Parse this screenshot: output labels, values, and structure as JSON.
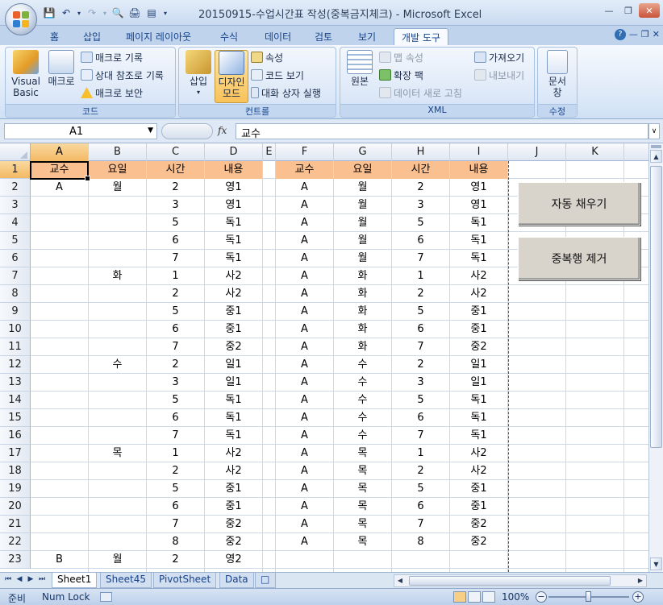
{
  "window": {
    "title": "20150915-수업시간표 작성(중복금지체크) - Microsoft Excel"
  },
  "tabs": [
    {
      "label": "홈"
    },
    {
      "label": "삽입"
    },
    {
      "label": "페이지 레이아웃"
    },
    {
      "label": "수식"
    },
    {
      "label": "데이터"
    },
    {
      "label": "검토"
    },
    {
      "label": "보기"
    },
    {
      "label": "개발 도구",
      "active": true
    }
  ],
  "ribbon": {
    "code": {
      "label": "코드",
      "visual_basic": "Visual Basic",
      "macro": "매크로",
      "record_macro": "매크로 기록",
      "relative_ref": "상대 참조로 기록",
      "macro_security": "매크로 보안"
    },
    "controls": {
      "label": "컨트롤",
      "insert": "삽입",
      "design_mode": "디자인 모드",
      "properties": "속성",
      "view_code": "코드 보기",
      "run_dialog": "대화 상자 실행"
    },
    "xml": {
      "label": "XML",
      "source": "원본",
      "map_properties": "맵 속성",
      "expansion_packs": "확장 팩",
      "refresh_data": "데이터 새로 고침",
      "import": "가져오기",
      "export": "내보내기"
    },
    "modify": {
      "label": "수정",
      "document_panel": "문서 창"
    }
  },
  "formula_bar": {
    "name_box": "A1",
    "fx": "fx",
    "value": "교수"
  },
  "columns": [
    "A",
    "B",
    "C",
    "D",
    "E",
    "F",
    "G",
    "H",
    "I",
    "J",
    "K"
  ],
  "rows": [
    "1",
    "2",
    "3",
    "4",
    "5",
    "6",
    "7",
    "8",
    "9",
    "10",
    "11",
    "12",
    "13",
    "14",
    "15",
    "16",
    "17",
    "18",
    "19",
    "20",
    "21",
    "22",
    "23"
  ],
  "left_table": {
    "headers": [
      "교수",
      "요일",
      "시간",
      "내용"
    ],
    "rows": [
      [
        "A",
        "월",
        "2",
        "영1"
      ],
      [
        "",
        "",
        "3",
        "영1"
      ],
      [
        "",
        "",
        "5",
        "독1"
      ],
      [
        "",
        "",
        "6",
        "독1"
      ],
      [
        "",
        "",
        "7",
        "독1"
      ],
      [
        "",
        "화",
        "1",
        "사2"
      ],
      [
        "",
        "",
        "2",
        "사2"
      ],
      [
        "",
        "",
        "5",
        "중1"
      ],
      [
        "",
        "",
        "6",
        "중1"
      ],
      [
        "",
        "",
        "7",
        "중2"
      ],
      [
        "",
        "수",
        "2",
        "일1"
      ],
      [
        "",
        "",
        "3",
        "일1"
      ],
      [
        "",
        "",
        "5",
        "독1"
      ],
      [
        "",
        "",
        "6",
        "독1"
      ],
      [
        "",
        "",
        "7",
        "독1"
      ],
      [
        "",
        "목",
        "1",
        "사2"
      ],
      [
        "",
        "",
        "2",
        "사2"
      ],
      [
        "",
        "",
        "5",
        "중1"
      ],
      [
        "",
        "",
        "6",
        "중1"
      ],
      [
        "",
        "",
        "7",
        "중2"
      ],
      [
        "",
        "",
        "8",
        "중2"
      ],
      [
        "B",
        "월",
        "2",
        "영2"
      ]
    ]
  },
  "right_table": {
    "headers": [
      "교수",
      "요일",
      "시간",
      "내용"
    ],
    "rows": [
      [
        "A",
        "월",
        "2",
        "영1"
      ],
      [
        "A",
        "월",
        "3",
        "영1"
      ],
      [
        "A",
        "월",
        "5",
        "독1"
      ],
      [
        "A",
        "월",
        "6",
        "독1"
      ],
      [
        "A",
        "월",
        "7",
        "독1"
      ],
      [
        "A",
        "화",
        "1",
        "사2"
      ],
      [
        "A",
        "화",
        "2",
        "사2"
      ],
      [
        "A",
        "화",
        "5",
        "중1"
      ],
      [
        "A",
        "화",
        "6",
        "중1"
      ],
      [
        "A",
        "화",
        "7",
        "중2"
      ],
      [
        "A",
        "수",
        "2",
        "일1"
      ],
      [
        "A",
        "수",
        "3",
        "일1"
      ],
      [
        "A",
        "수",
        "5",
        "독1"
      ],
      [
        "A",
        "수",
        "6",
        "독1"
      ],
      [
        "A",
        "수",
        "7",
        "독1"
      ],
      [
        "A",
        "목",
        "1",
        "사2"
      ],
      [
        "A",
        "목",
        "2",
        "사2"
      ],
      [
        "A",
        "목",
        "5",
        "중1"
      ],
      [
        "A",
        "목",
        "6",
        "중1"
      ],
      [
        "A",
        "목",
        "7",
        "중2"
      ],
      [
        "A",
        "목",
        "8",
        "중2"
      ]
    ]
  },
  "buttons": {
    "autofill": "자동 채우기",
    "remove_duplicates": "중복행 제거"
  },
  "sheet_tabs": [
    {
      "label": "Sheet1",
      "active": true
    },
    {
      "label": "Sheet45"
    },
    {
      "label": "PivotSheet"
    },
    {
      "label": "Data"
    }
  ],
  "status": {
    "ready": "준비",
    "num_lock": "Num Lock",
    "zoom": "100%",
    "zoom_value": 100
  },
  "colors": {
    "header_fill": "#fac090",
    "active_tab_text": "#15428b",
    "selection_header": "#f3b964"
  }
}
